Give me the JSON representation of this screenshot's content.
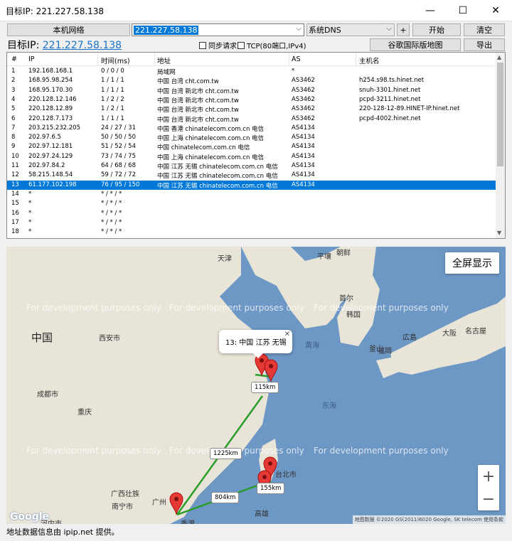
{
  "window": {
    "title": "目标IP: 221.227.58.138",
    "minimize": "—",
    "maximize": "☐",
    "close": "✕"
  },
  "toolbar": {
    "local_network_label": "本机网络",
    "ip_input_value": "221.227.58.138",
    "dns_select_value": "系统DNS",
    "add_label": "+",
    "start_label": "开始",
    "clear_label": "清空",
    "google_map_label": "谷歌国际版地图",
    "export_label": "导出"
  },
  "target": {
    "label": "目标IP: ",
    "ip": "221.227.58.138"
  },
  "options": {
    "sync_request": "同步请求",
    "tcp_mode": "TCP(80端口,IPv4)"
  },
  "table": {
    "headers": [
      "#",
      "IP",
      "时间(ms)",
      "地址",
      "AS",
      "主机名"
    ],
    "rows": [
      [
        "1",
        "192.168.168.1",
        "0 / 0 / 0",
        "局域网",
        "*",
        ""
      ],
      [
        "2",
        "168.95.98.254",
        "1 / 1 / 1",
        "中国 台湾 cht.com.tw",
        "AS3462",
        "h254.s98.ts.hinet.net"
      ],
      [
        "3",
        "168.95.170.30",
        "1 / 1 / 1",
        "中国 台湾 新北市 cht.com.tw",
        "AS3462",
        "snuh-3301.hinet.net"
      ],
      [
        "4",
        "220.128.12.146",
        "1 / 2 / 2",
        "中国 台湾 新北市 cht.com.tw",
        "AS3462",
        "pcpd-3211.hinet.net"
      ],
      [
        "5",
        "220.128.12.89",
        "1 / 2 / 1",
        "中国 台湾 新北市 cht.com.tw",
        "AS3462",
        "220-128-12-89.HINET-IP.hinet.net"
      ],
      [
        "6",
        "220.128.7.173",
        "1 / 1 / 1",
        "中国 台湾 新北市 cht.com.tw",
        "AS3462",
        "pcpd-4002.hinet.net"
      ],
      [
        "7",
        "203.215.232.205",
        "24 / 27 / 31",
        "中国 香港 chinatelecom.com.cn 电信",
        "AS4134",
        ""
      ],
      [
        "8",
        "202.97.6.5",
        "50 / 50 / 50",
        "中国 上海 chinatelecom.com.cn 电信",
        "AS4134",
        ""
      ],
      [
        "9",
        "202.97.12.181",
        "51 / 52 / 54",
        "中国 chinatelecom.com.cn 电信",
        "AS4134",
        ""
      ],
      [
        "10",
        "202.97.24.129",
        "73 / 74 / 75",
        "中国 上海 chinatelecom.com.cn 电信",
        "AS4134",
        ""
      ],
      [
        "11",
        "202.97.84.2",
        "64 / 68 / 68",
        "中国 江苏 无锡 chinatelecom.com.cn 电信",
        "AS4134",
        ""
      ],
      [
        "12",
        "58.215.148.54",
        "59 / 72 / 72",
        "中国 江苏 无锡 chinatelecom.com.cn 电信",
        "AS4134",
        ""
      ],
      [
        "13",
        "61.177.102.198",
        "76 / 95 / 150",
        "中国 江苏 无锡 chinatelecom.com.cn 电信",
        "AS4134",
        ""
      ],
      [
        "14",
        "*",
        "* / * / *",
        "",
        "",
        ""
      ],
      [
        "15",
        "*",
        "* / * / *",
        "",
        "",
        ""
      ],
      [
        "16",
        "*",
        "* / * / *",
        "",
        "",
        ""
      ],
      [
        "17",
        "*",
        "* / * / *",
        "",
        "",
        ""
      ],
      [
        "18",
        "*",
        "* / * / *",
        "",
        "",
        ""
      ]
    ],
    "selected_row": 12
  },
  "map": {
    "fullscreen_label": "全屏显示",
    "watermark": "For development purposes only",
    "infowindow_text": "13: 中国 江苏 无锡",
    "infowindow_close": "✕",
    "distances": [
      "115km",
      "1225km",
      "804km",
      "155km"
    ],
    "place_labels": {
      "china": "中国",
      "tianjin": "天津",
      "pyongyang": "平壤",
      "korea": "朝鲜",
      "seoul": "首尔",
      "southkorea": "韩国",
      "busan": "釜山",
      "xian": "西安市",
      "chengdu": "成都市",
      "chongqing": "重庆",
      "japan_hiroshima": "広島",
      "osaka": "大阪",
      "nagoya": "名古屋",
      "fukuoka": "福岡",
      "nanning": "南宁市",
      "guangzhou": "广州",
      "hongkong": "香港",
      "taiwan": "台湾",
      "taibei": "台北市",
      "gaoxiong": "高雄",
      "hanoi": "河内市",
      "donghai": "东海",
      "guangxi": "广西壮族",
      "huanghai": "黄海"
    },
    "zoom_in": "+",
    "zoom_out": "−",
    "google_logo": "Google",
    "attribution": "地图数据 ©2020 GS(2011)6020 Google, SK telecom  使用条款"
  },
  "status": {
    "text": "地址数据信息由 ipip.net 提供。"
  }
}
